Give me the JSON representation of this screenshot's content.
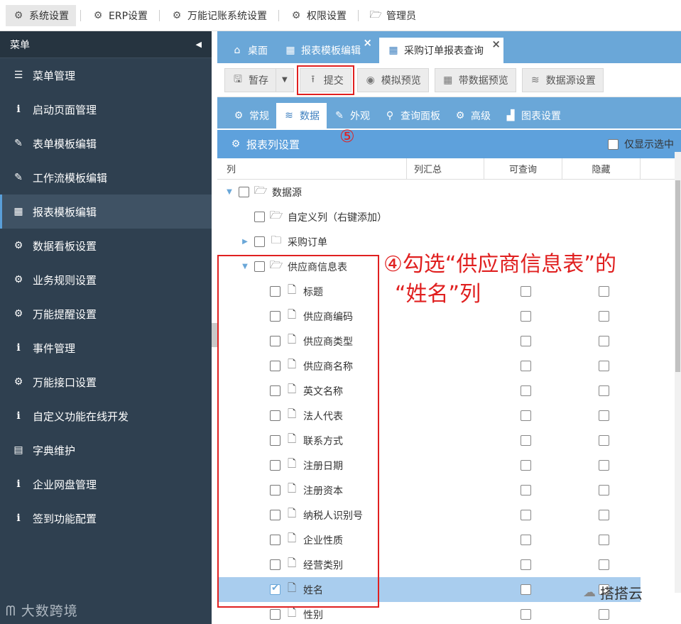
{
  "topnav": {
    "items": [
      {
        "label": "系统设置",
        "icon": "gear-icon",
        "active": true
      },
      {
        "label": "ERP设置",
        "icon": "gear-icon"
      },
      {
        "label": "万能记账系统设置",
        "icon": "gear-icon"
      },
      {
        "label": "权限设置",
        "icon": "gear-icon"
      },
      {
        "label": "管理员",
        "icon": "folder-icon"
      }
    ]
  },
  "sidebar": {
    "title": "菜单",
    "items": [
      {
        "label": "菜单管理",
        "icon": "list-icon"
      },
      {
        "label": "启动页面管理",
        "icon": "info-icon"
      },
      {
        "label": "表单模板编辑",
        "icon": "edit-icon"
      },
      {
        "label": "工作流模板编辑",
        "icon": "edit-icon"
      },
      {
        "label": "报表模板编辑",
        "icon": "table-icon",
        "active": true
      },
      {
        "label": "数据看板设置",
        "icon": "gear-icon"
      },
      {
        "label": "业务规则设置",
        "icon": "gear-icon"
      },
      {
        "label": "万能提醒设置",
        "icon": "gear-icon"
      },
      {
        "label": "事件管理",
        "icon": "info-icon"
      },
      {
        "label": "万能接口设置",
        "icon": "gear-icon"
      },
      {
        "label": "自定义功能在线开发",
        "icon": "info-icon"
      },
      {
        "label": "字典维护",
        "icon": "dictionary-icon"
      },
      {
        "label": "企业网盘管理",
        "icon": "info-icon"
      },
      {
        "label": "签到功能配置",
        "icon": "info-icon"
      }
    ],
    "watermark": "大数跨境"
  },
  "tabs": [
    {
      "label": "桌面",
      "icon": "home-icon"
    },
    {
      "label": "报表模板编辑",
      "icon": "table-icon",
      "closable": true
    },
    {
      "label": "采购订单报表查询",
      "icon": "table-icon",
      "closable": true,
      "active": true
    }
  ],
  "toolbar": {
    "save_label": "暂存",
    "submit_label": "提交",
    "preview_label": "模拟预览",
    "data_preview_label": "带数据预览",
    "datasource_label": "数据源设置"
  },
  "subtabs": [
    {
      "label": "常规",
      "icon": "gear-icon"
    },
    {
      "label": "数据",
      "icon": "database-icon",
      "active": true
    },
    {
      "label": "外观",
      "icon": "magic-icon"
    },
    {
      "label": "查询面板",
      "icon": "search-icon"
    },
    {
      "label": "高级",
      "icon": "gears-icon"
    },
    {
      "label": "图表设置",
      "icon": "chart-icon"
    }
  ],
  "panel": {
    "title": "报表列设置",
    "only_selected_label": "仅显示选中"
  },
  "columns": {
    "col": "列",
    "sum": "列汇总",
    "queryable": "可查询",
    "hidden": "隐藏"
  },
  "tree": [
    {
      "label": "数据源",
      "level": 0,
      "type": "folder-open",
      "arrow": "down"
    },
    {
      "label": "自定义列（右键添加）",
      "level": 1,
      "type": "folder-open"
    },
    {
      "label": "采购订单",
      "level": 1,
      "type": "folder",
      "arrow": "right"
    },
    {
      "label": "供应商信息表",
      "level": 1,
      "type": "folder-open",
      "arrow": "down"
    },
    {
      "label": "标题",
      "level": 2,
      "type": "file",
      "extra": true
    },
    {
      "label": "供应商编码",
      "level": 2,
      "type": "file",
      "extra": true
    },
    {
      "label": "供应商类型",
      "level": 2,
      "type": "file",
      "extra": true
    },
    {
      "label": "供应商名称",
      "level": 2,
      "type": "file",
      "extra": true
    },
    {
      "label": "英文名称",
      "level": 2,
      "type": "file",
      "extra": true
    },
    {
      "label": "法人代表",
      "level": 2,
      "type": "file",
      "extra": true
    },
    {
      "label": "联系方式",
      "level": 2,
      "type": "file",
      "extra": true
    },
    {
      "label": "注册日期",
      "level": 2,
      "type": "file",
      "extra": true
    },
    {
      "label": "注册资本",
      "level": 2,
      "type": "file",
      "extra": true
    },
    {
      "label": "纳税人识别号",
      "level": 2,
      "type": "file",
      "extra": true
    },
    {
      "label": "企业性质",
      "level": 2,
      "type": "file",
      "extra": true
    },
    {
      "label": "经营类别",
      "level": 2,
      "type": "file",
      "extra": true
    },
    {
      "label": "姓名",
      "level": 2,
      "type": "file",
      "extra": true,
      "checked": true,
      "selected": true
    },
    {
      "label": "性别",
      "level": 2,
      "type": "file",
      "extra": true
    }
  ],
  "annotations": {
    "step4_line1": "④勾选“供应商信息表”的",
    "step4_line2": "“姓名”列",
    "step5": "⑤",
    "wechat": "搭搭云"
  }
}
